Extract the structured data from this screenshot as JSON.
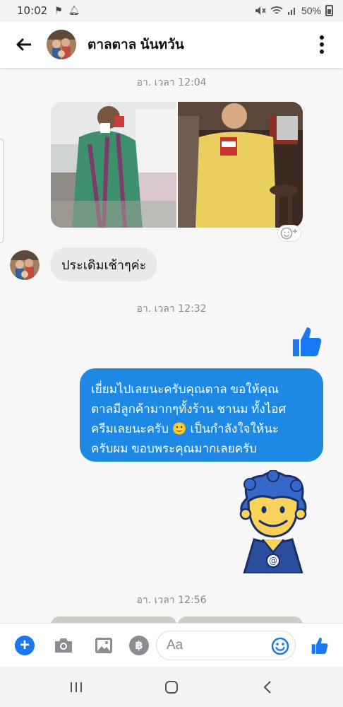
{
  "status_bar": {
    "time": "10:02",
    "battery": "50%"
  },
  "header": {
    "contact_name": "ตาลตาล นันทวัน",
    "back_icon": "arrow-left-icon",
    "more_icon": "more-vertical-icon"
  },
  "messages": [
    {
      "timestamp": "อา. เวลา 12:04"
    },
    {
      "incoming_text": "ประเดิมเช้าๆค่ะ"
    },
    {
      "timestamp": "อา. เวลา 12:32"
    },
    {
      "outgoing_text": "เยี่ยมไปเลยนะครับคุณตาล ขอให้คุณตาลมีลูกค้ามากๆทั้งร้าน ชานม ทั้งไอศครีมเลยนะครับ 🙂 เป็นกำลังใจให้นะครับผม ขอบพระคุณมากเลยครับ"
    },
    {
      "timestamp": "อา. เวลา 12:56"
    }
  ],
  "outgoing_lines": [
    "เยี่ยมไปเลยนะครับคุณตาล ขอให้คุณ",
    "ตาลมีลูกค้ามากๆทั้งร้าน ชานม ทั้งไอศ",
    "ครีมเลยนะครับ 🙂 เป็นกำลังใจให้นะ",
    "ครับผม ขอบพระคุณมากเลยครับ"
  ],
  "composer": {
    "placeholder": "Aa",
    "baht_symbol": "฿"
  },
  "colors": {
    "accent": "#1877f2",
    "outgoing_bubble": "#1e88e5",
    "incoming_bubble": "#e9e9eb",
    "chat_background": "#f7f7f7"
  }
}
